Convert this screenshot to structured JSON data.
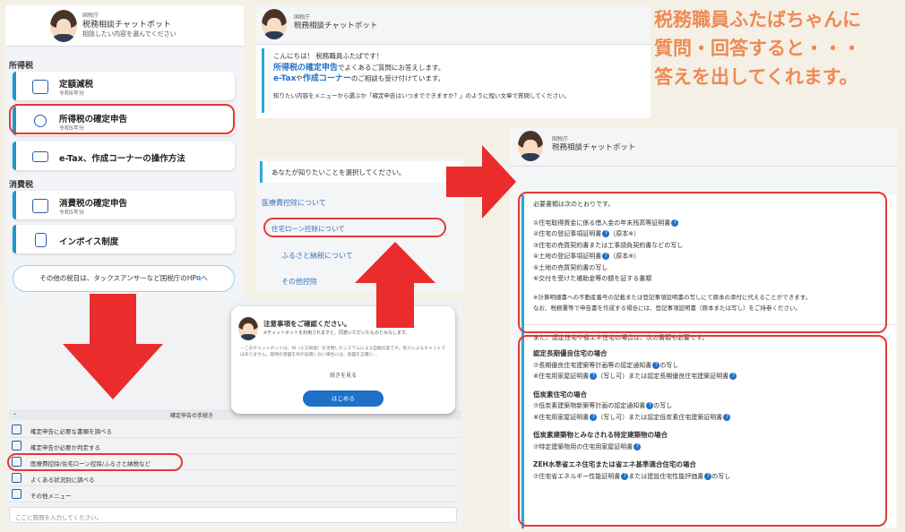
{
  "caption": {
    "line1": "税務職員ふたばちゃんに",
    "line2": "質問・回答すると・・・",
    "line3": "答えを出してくれます。"
  },
  "panel1": {
    "agency": "国税庁",
    "title": "税務相談チャットボット",
    "subtitle": "相談したい内容を選んでください",
    "section_income": "所得税",
    "items": [
      {
        "title": "定額減税",
        "sub": "令和6年分"
      },
      {
        "title": "所得税の確定申告",
        "sub": "令和5年分"
      },
      {
        "title": "e-Tax、作成コーナーの操作方法",
        "sub": ""
      }
    ],
    "section_consumption": "消費税",
    "items2": [
      {
        "title": "消費税の確定申告",
        "sub": "令和5年分"
      },
      {
        "title": "インボイス制度",
        "sub": ""
      }
    ],
    "other": "その他の税目は、タックスアンサーなど国税庁のHP",
    "other_suffix": "へ"
  },
  "panel2": {
    "agency": "国税庁",
    "title": "税務相談チャットボット",
    "greet": "こんにちは！ 税務職員ふたばです！",
    "l2a": "所得税の確定申告",
    "l2b": "でよくあるご質問にお答えします。",
    "l3a": "e-Tax",
    "l3b": "や",
    "l3c": "作成コーナー",
    "l3d": "のご相談も受け付けています。",
    "l4": "知りたい内容をメニューから選ぶか「確定申告はいつまでできますか？」のように短い文章で質問してください。"
  },
  "panel3": {
    "prompt": "あなたが知りたいことを選択してください。",
    "items": [
      "医療費控除について",
      "住宅ローン控除について",
      "ふるさと納税について",
      "その他控除"
    ]
  },
  "panel4": {
    "dialog_title": "注意事項をご確認ください。",
    "dialog_sub": "※チャットボットを利用されますと、同意いただいたものとみなします。",
    "dialog_body": "・このチャットボットは、AI（人工知能）を活用したシステムによる自動応答です。有人によるチャットではありません。質問の意図をAIが認識しない場合には、意図を正確に…",
    "more": "続きを見る",
    "start": "はじめる",
    "menu_header": "確定申告の手続き",
    "menu": [
      "確定申告に必要な書類を調べる",
      "確定申告が必要か判定する",
      "医療費控除/住宅ローン控除/ふるさと納税など",
      "よくある状況別に調べる",
      "その他メニュー"
    ],
    "input_placeholder": "ここに質問を入力してください。"
  },
  "panel5": {
    "agency": "国税庁",
    "title": "税務相談チャットボット",
    "intro": "必要書類は次のとおりです。",
    "docs": [
      "①住宅取得資金に係る借入金の年末残高等証明書",
      "②住宅の登記事項証明書",
      "③住宅の売買契約書または工事請負契約書などの写し",
      "④土地の登記事項証明書",
      "⑤土地の売買契約書の写し",
      "⑥交付を受けた補助金等の額を証する書類"
    ],
    "doc2_suffix": "（原本※）",
    "doc4_suffix": "（原本※）",
    "note1": "※計算明細書への不動産番号の記載または登記事項証明書の写しにて原本の添付に代えることができます。",
    "note2": "なお、税務署等で申告書を作成する場合には、登記事項証明書（原本または写し）をご持参ください。",
    "also": "また、認定住宅や省エネ住宅の場合は、次の書類も必要です。",
    "s1": "認定長期優良住宅の場合",
    "s1a": "⑦長期優良住宅建築等計画等の認定通知書",
    "s1a2": "の写し",
    "s1b": "⑧住宅用家屋証明書",
    "s1b2": "（写し可）または認定長期優良住宅建築証明書",
    "s2": "低炭素住宅の場合",
    "s2a": "⑦低炭素建築物新築等計画の認定通知書",
    "s2a2": "の写し",
    "s2b": "⑧住宅用家屋証明書",
    "s2b2": "（写し可）または認定低炭素住宅建築証明書",
    "s3": "低炭素建築物とみなされる特定建築物の場合",
    "s3a": "⑦特定建築物用の住宅用家屋証明書",
    "s4": "ZEH水準省エネ住宅または省エネ基準適合住宅の場合",
    "s4a": "⑦住宅省エネルギー性能証明書",
    "s4a2": "または建設住宅性能評価書",
    "s4a3": "の写し"
  },
  "colors": {
    "red": "#e53935",
    "orange": "#ef8a54",
    "blue": "#1e70c8"
  }
}
